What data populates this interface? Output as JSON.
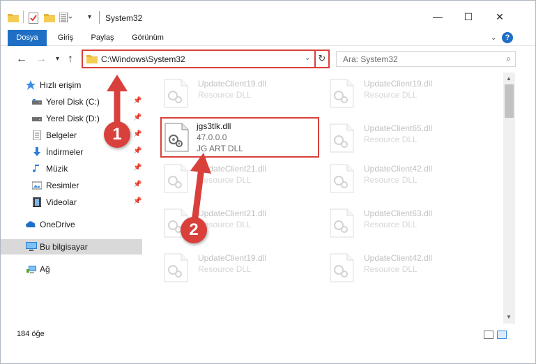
{
  "titlebar": {
    "title": "System32",
    "minimize_symbol": "—",
    "maximize_symbol": "☐",
    "close_symbol": "✕"
  },
  "ribbon": {
    "tabs": [
      {
        "label": "Dosya",
        "active": true
      },
      {
        "label": "Giriş",
        "active": false
      },
      {
        "label": "Paylaş",
        "active": false
      },
      {
        "label": "Görünüm",
        "active": false
      }
    ],
    "help_symbol": "?"
  },
  "address": {
    "path": "C:\\Windows\\System32",
    "search_placeholder": "Ara: System32"
  },
  "sidebar": {
    "items": [
      {
        "label": "Hızlı erişim",
        "icon": "star-icon",
        "pinned": false
      },
      {
        "label": "Yerel Disk (C:)",
        "icon": "drive-icon",
        "pinned": true
      },
      {
        "label": "Yerel Disk (D:)",
        "icon": "drive-icon",
        "pinned": true
      },
      {
        "label": "Belgeler",
        "icon": "documents-icon",
        "pinned": true
      },
      {
        "label": "İndirmeler",
        "icon": "download-icon",
        "pinned": true
      },
      {
        "label": "Müzik",
        "icon": "music-icon",
        "pinned": true
      },
      {
        "label": "Resimler",
        "icon": "pictures-icon",
        "pinned": true
      },
      {
        "label": "Videolar",
        "icon": "video-icon",
        "pinned": true
      },
      {
        "label": "OneDrive",
        "icon": "cloud-icon",
        "pinned": false
      },
      {
        "label": "Bu bilgisayar",
        "icon": "computer-icon",
        "pinned": false,
        "selected": true
      },
      {
        "label": "Ağ",
        "icon": "network-icon",
        "pinned": false
      }
    ]
  },
  "files": {
    "highlighted": {
      "name": "jgs3tlk.dll",
      "version": "47.0.0.0",
      "description": "JG ART DLL"
    },
    "faded": [
      {
        "name": "UpdateClient19.dll",
        "type": "Resource DLL"
      },
      {
        "name": "UpdateClient19.dll",
        "type": "Resource DLL"
      },
      {
        "name": "UpdateClient65.dll",
        "type": "Resource DLL"
      },
      {
        "name": "UpdateClient21.dll",
        "type": "Resource DLL"
      },
      {
        "name": "UpdateClient42.dll",
        "type": "Resource DLL"
      },
      {
        "name": "UpdateClient21.dll",
        "type": "Resource DLL"
      },
      {
        "name": "UpdateClient63.dll",
        "type": "Resource DLL"
      },
      {
        "name": "UpdateClient19.dll",
        "type": "Resource DLL"
      },
      {
        "name": "UpdateClient42.dll",
        "type": "Resource DLL"
      }
    ]
  },
  "status": {
    "item_count": "184 öğe"
  },
  "annotations": {
    "step1": "1",
    "step2": "2"
  },
  "colors": {
    "accent": "#1f6fc5",
    "highlight": "#d9403c"
  }
}
